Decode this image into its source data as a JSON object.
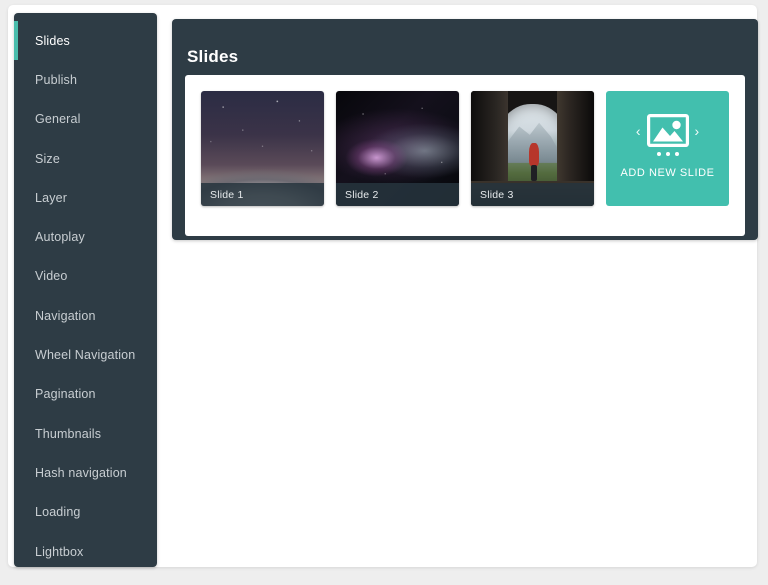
{
  "sidebar": {
    "items": [
      {
        "label": "Slides",
        "active": true
      },
      {
        "label": "Publish",
        "active": false
      },
      {
        "label": "General",
        "active": false
      },
      {
        "label": "Size",
        "active": false
      },
      {
        "label": "Layer",
        "active": false
      },
      {
        "label": "Autoplay",
        "active": false
      },
      {
        "label": "Video",
        "active": false
      },
      {
        "label": "Navigation",
        "active": false
      },
      {
        "label": "Wheel Navigation",
        "active": false
      },
      {
        "label": "Pagination",
        "active": false
      },
      {
        "label": "Thumbnails",
        "active": false
      },
      {
        "label": "Hash navigation",
        "active": false
      },
      {
        "label": "Loading",
        "active": false
      },
      {
        "label": "Lightbox",
        "active": false
      }
    ]
  },
  "main": {
    "title": "Slides",
    "slides": [
      {
        "label": "Slide 1",
        "thumb": "starry-sky-snowy-mountains"
      },
      {
        "label": "Slide 2",
        "thumb": "deep-space-galaxy"
      },
      {
        "label": "Slide 3",
        "thumb": "cave-opening-hiker-mountains"
      }
    ],
    "add_slide": {
      "label": "ADD NEW SLIDE",
      "icon": "image-placeholder-icon",
      "prev_icon": "chevron-left-icon",
      "next_icon": "chevron-right-icon"
    }
  },
  "colors": {
    "panel_dark": "#2e3c45",
    "accent_teal": "#42bfae",
    "active_bar": "#4abdac",
    "page_background": "#eeeeee",
    "card_white": "#ffffff",
    "nav_text": "#c8ced2"
  }
}
